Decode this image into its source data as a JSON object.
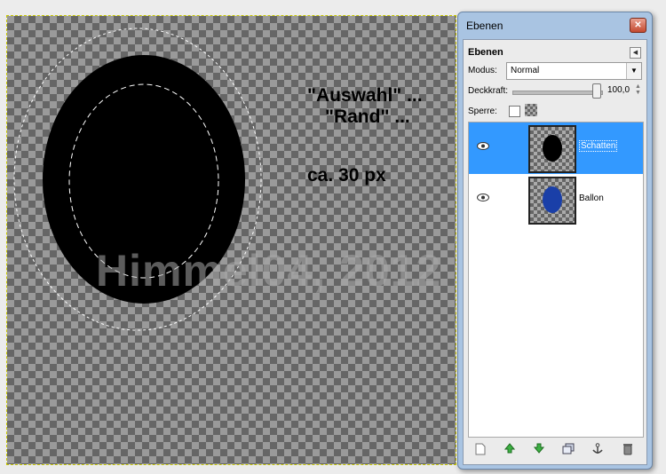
{
  "canvas": {
    "annotation_line1": "\"Auswahl\" ...",
    "annotation_line2": "\"Rand\" ...",
    "annotation_line3": "ca. 30 px",
    "watermark": "Himmel04, 2012"
  },
  "dialog": {
    "title": "Ebenen",
    "close_icon": "close-icon",
    "panel_header": "Ebenen",
    "mode_label": "Modus:",
    "mode_value": "Normal",
    "opacity_label": "Deckkraft:",
    "opacity_value": "100,0",
    "opacity_fraction": 1.0,
    "lock_label": "Sperre:",
    "layers": [
      {
        "name": "Schatten",
        "selected": true,
        "thumb_color": "#000000"
      },
      {
        "name": "Ballon",
        "selected": false,
        "thumb_color": "#1a3fa8"
      }
    ],
    "toolbar_icons": [
      "new-layer-icon",
      "raise-layer-icon",
      "lower-layer-icon",
      "duplicate-layer-icon",
      "anchor-layer-icon",
      "delete-layer-icon"
    ]
  },
  "colors": {
    "selection_highlight": "#3399ff",
    "dialog_frame": "#a9c4e2",
    "raise_lower_arrows": "#3cb043"
  }
}
